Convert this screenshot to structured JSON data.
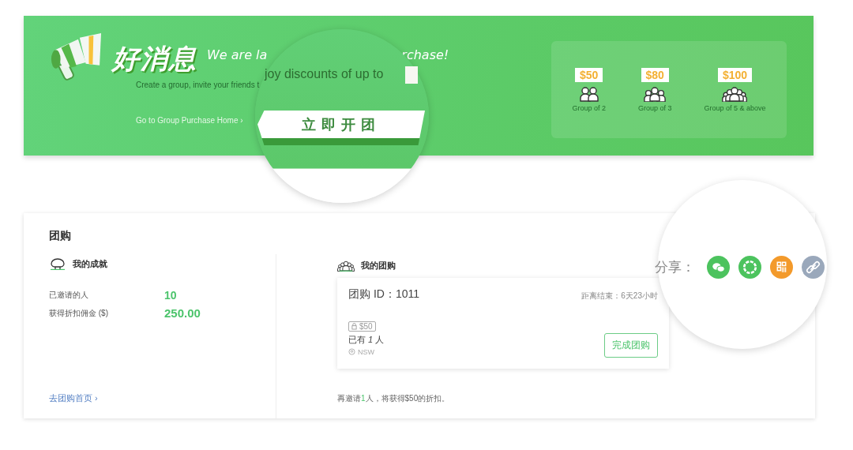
{
  "banner": {
    "headline": "好消息",
    "tagline_start": "We are la",
    "tagline_end": "rchase!",
    "subtitle": "Create a group, invite your friends t",
    "home_link": "Go to Group Purchase Home ›",
    "tiers": [
      {
        "price": "$50",
        "label": "Group of 2",
        "kind": "pair"
      },
      {
        "price": "$80",
        "label": "Group of 3",
        "kind": "trio"
      },
      {
        "price": "$100",
        "label": "Group of 5 & above",
        "kind": "crowd"
      }
    ]
  },
  "banner_lens": {
    "subtitle": "joy discounts of up to",
    "button": "立即开团"
  },
  "group_purchase": {
    "title": "团购",
    "achievements": {
      "heading": "我的成就",
      "stats": [
        {
          "label": "已邀请的人",
          "value": "10"
        },
        {
          "label": "获得折扣佣金 ($)",
          "value": "250.00"
        }
      ],
      "link": "去团购首页 ›"
    },
    "my_groups": {
      "heading": "我的团购",
      "group": {
        "id_label": "团购 ID：1011",
        "countdown": "距离结束：6天23小时",
        "tag": "$50",
        "members": "已有 *1* 人",
        "location": "NSW",
        "button": "完成团购"
      },
      "note": "再邀请**1**人，将获得$50的折扣。"
    }
  },
  "share_lens": {
    "label": "分享：",
    "buttons": [
      {
        "kind": "chat",
        "color": "#4cc35e"
      },
      {
        "kind": "aperture",
        "color": "#4cc35e"
      },
      {
        "kind": "qr",
        "color": "#f39a2b"
      },
      {
        "kind": "link",
        "color": "#9aa8bb"
      }
    ]
  }
}
